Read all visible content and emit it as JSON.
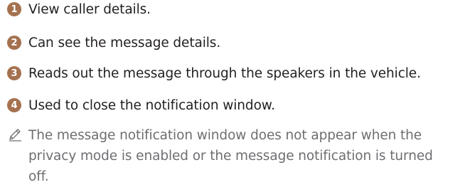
{
  "colors": {
    "badge": "#a5714f",
    "text": "#231f20",
    "note_text": "#6d6e71"
  },
  "items": [
    {
      "number": "1",
      "text": "View caller details."
    },
    {
      "number": "2",
      "text": "Can see the message details."
    },
    {
      "number": "3",
      "text": "Reads out the message through the speakers in the vehicle."
    },
    {
      "number": "4",
      "text": "Used to close the notification window."
    }
  ],
  "note": {
    "icon": "pencil-icon",
    "text": "The message notification window does not appear when the privacy mode is enabled or the message notification is turned off."
  }
}
